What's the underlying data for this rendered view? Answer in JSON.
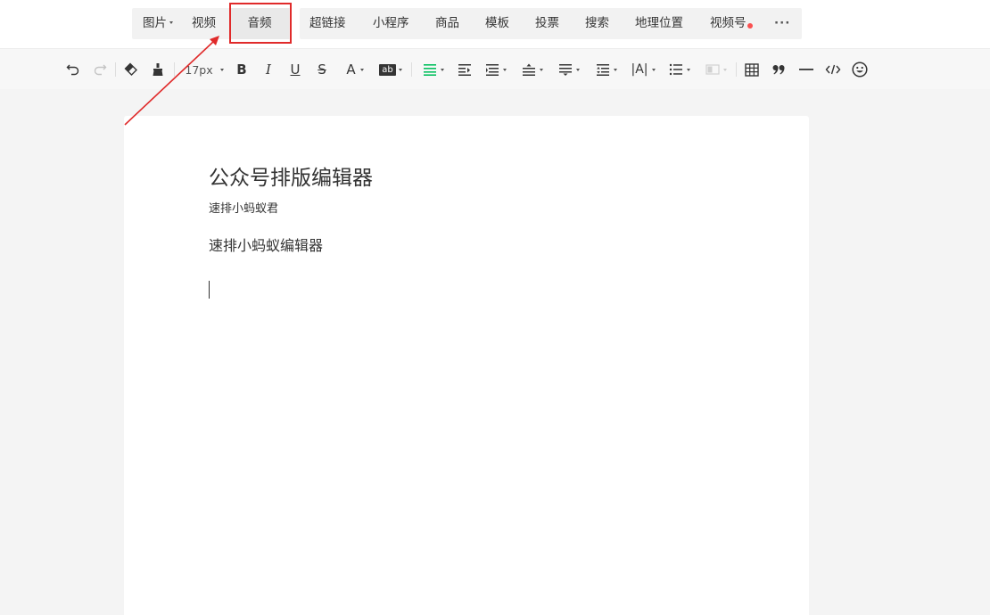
{
  "insert_bar": {
    "image": "图片",
    "video": "视频",
    "audio": "音频",
    "hyperlink": "超链接",
    "mini_program": "小程序",
    "product": "商品",
    "template": "模板",
    "vote": "投票",
    "search": "搜索",
    "location": "地理位置",
    "channels": "视频号",
    "more": "···"
  },
  "format_toolbar": {
    "font_size": "17px",
    "bold": "B",
    "italic": "I",
    "underline": "U",
    "strikethrough": "S",
    "font_color": "A",
    "background_color": "ab",
    "line_height": "|A|",
    "accent_color": "#07c160"
  },
  "document": {
    "title": "公众号排版编辑器",
    "author": "速排小蚂蚁君",
    "body": "速排小蚂蚁编辑器"
  },
  "annotation": {
    "highlight_color": "#e02a2a"
  }
}
